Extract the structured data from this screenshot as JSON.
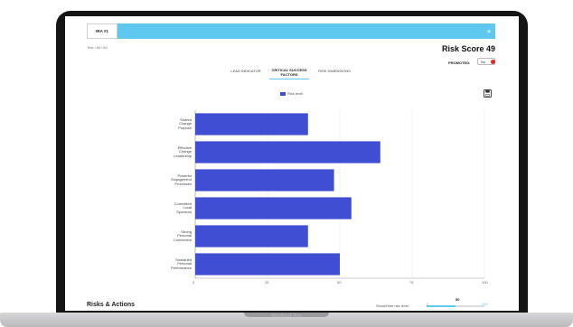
{
  "device": {
    "model": "MacBook Pro"
  },
  "app": {
    "tab_label": "IRA #1",
    "add_symbol": "+",
    "test_label": "Test / All \\ All",
    "risk_score": "Risk Score 49",
    "promoted_label": "PROMOTED:",
    "promoted_value": "No",
    "status_color": "#e8242a"
  },
  "tabs": [
    {
      "label": "LEAD INDICATOR",
      "active": false
    },
    {
      "label": "CRITICAL SUCCESS FACTORS",
      "active": true
    },
    {
      "label": "RISK DIMENSIONS",
      "active": false
    }
  ],
  "footer": {
    "section_title": "Risks & Actions",
    "show_label": "Show/Hide risk level",
    "slider_min": "0",
    "slider_max": "100",
    "slider_value": "50"
  },
  "chart_data": {
    "type": "bar",
    "orientation": "horizontal",
    "categories": [
      "Shared Change Purpose",
      "Effective Change Leadership",
      "Powerful Engagement Processes",
      "Committed Local Sponsors",
      "Strong Personal Connection",
      "Sustained Personal Performance"
    ],
    "series": [
      {
        "name": "Risk level",
        "values": [
          39,
          64,
          48,
          54,
          39,
          50
        ]
      }
    ],
    "xlim": [
      0,
      100
    ],
    "xticks": [
      0,
      25,
      50,
      75,
      100
    ],
    "bar_color": "#3f4ed3",
    "legend_position": "top-center"
  }
}
